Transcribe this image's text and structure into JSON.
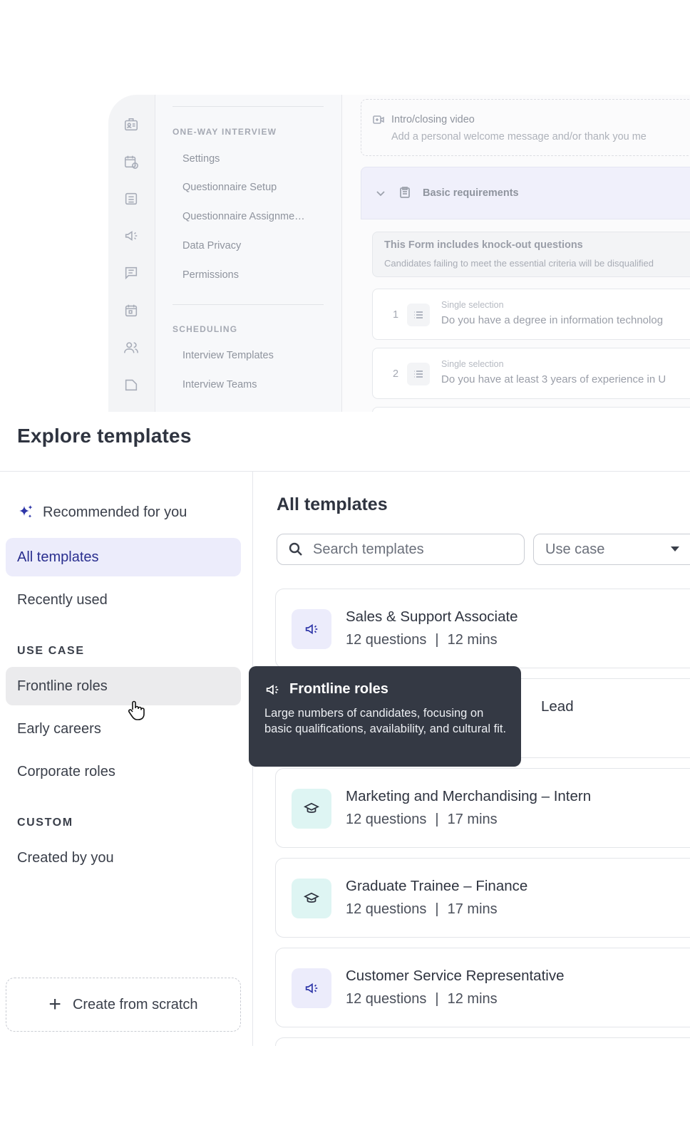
{
  "background_app": {
    "nav": {
      "section1_heading": "ONE-WAY INTERVIEW",
      "section1_items": [
        "Settings",
        "Questionnaire Setup",
        "Questionnaire Assignme…",
        "Data Privacy",
        "Permissions"
      ],
      "section2_heading": "SCHEDULING",
      "section2_items": [
        "Interview Templates",
        "Interview Teams"
      ]
    },
    "intro": {
      "title": "Intro/closing video",
      "subtitle": "Add a personal welcome message and/or thank you me"
    },
    "requirements": {
      "title": "Basic requirements"
    },
    "knockout": {
      "title": "This Form includes knock-out questions",
      "subtitle": "Candidates failing to meet the essential criteria will be disqualified"
    },
    "questions": [
      {
        "num": "1",
        "type": "Single selection",
        "text": "Do you have a degree in information technolog"
      },
      {
        "num": "2",
        "type": "Single selection",
        "text": "Do you have at least 3 years of experience in U"
      }
    ]
  },
  "modal": {
    "title": "Explore templates",
    "sidebar": {
      "recommended": "Recommended for you",
      "all_templates": "All templates",
      "recently_used": "Recently used",
      "use_case_heading": "USE CASE",
      "use_cases": [
        "Frontline roles",
        "Early careers",
        "Corporate roles"
      ],
      "custom_heading": "CUSTOM",
      "created_by_you": "Created by you",
      "create_button": "Create from scratch"
    },
    "main": {
      "title": "All templates",
      "search_placeholder": "Search templates",
      "use_case_select": "Use case",
      "templates": [
        {
          "name": "Sales & Support Associate",
          "questions": "12 questions",
          "duration": "12 mins",
          "icon": "megaphone-icon"
        },
        {
          "name": "Lead",
          "questions": "",
          "duration": "",
          "icon": "megaphone-icon"
        },
        {
          "name": "Marketing and Merchandising – Intern",
          "questions": "12 questions",
          "duration": "17 mins",
          "icon": "graduation-cap-icon"
        },
        {
          "name": "Graduate Trainee – Finance",
          "questions": "12 questions",
          "duration": "17 mins",
          "icon": "graduation-cap-icon"
        },
        {
          "name": "Customer Service Representative",
          "questions": "12 questions",
          "duration": "12 mins",
          "icon": "megaphone-icon"
        }
      ],
      "separator": "|"
    },
    "tooltip": {
      "title": "Frontline roles",
      "body": "Large numbers of candidates, focusing on basic qualifications, availability, and cultural fit."
    }
  },
  "colors": {
    "accent": "#2e36a8",
    "active_bg": "#ececfb",
    "hover_bg": "#ebebed",
    "tooltip_bg": "#343944",
    "teal_bg": "#def5f3"
  }
}
